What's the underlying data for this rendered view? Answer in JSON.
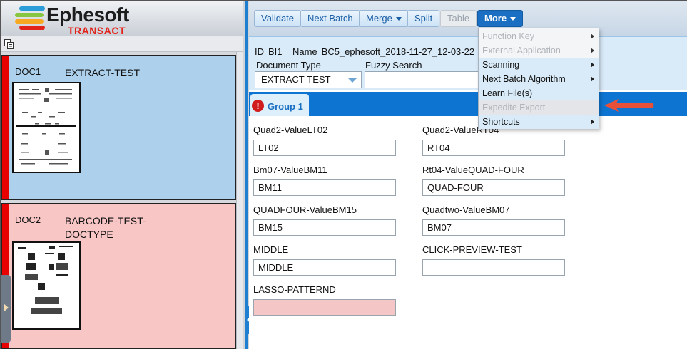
{
  "logo": {
    "word": "Ephesoft",
    "sub": "TRANSACT",
    "colors": [
      "#2a9cd8",
      "#88c540",
      "#f7a823",
      "#e2231a"
    ]
  },
  "left_toolbar": {
    "icon": "copy-icon"
  },
  "documents": [
    {
      "id": "DOC1",
      "type": "EXTRACT-TEST",
      "status_color": "#add1ec"
    },
    {
      "id": "DOC2",
      "type": "BARCODE-TEST-DOCTYPE",
      "status_color": "#f9c6c6"
    }
  ],
  "toolbar": {
    "validate": "Validate",
    "next_batch": "Next Batch",
    "merge": "Merge",
    "split": "Split",
    "table": "Table",
    "more": "More"
  },
  "more_menu": {
    "items": [
      {
        "label": "Function Key",
        "enabled": false,
        "submenu": true
      },
      {
        "label": "External Application",
        "enabled": false,
        "submenu": true
      },
      {
        "label": "Scanning",
        "enabled": true,
        "submenu": true
      },
      {
        "label": "Next Batch Algorithm",
        "enabled": true,
        "submenu": true
      },
      {
        "label": "Learn File(s)",
        "enabled": true,
        "submenu": false
      },
      {
        "label": "Expedite Export",
        "enabled": false,
        "submenu": false
      },
      {
        "label": "Shortcuts",
        "enabled": true,
        "submenu": true
      }
    ]
  },
  "batch": {
    "id_label": "ID",
    "id_value": "BI1",
    "name_label": "Name",
    "name_value": "BC5_ephesoft_2018-11-27_12-03-22",
    "doc_type_label": "Document Type",
    "doc_type_value": "EXTRACT-TEST",
    "fuzzy_label": "Fuzzy Search",
    "fuzzy_value": ""
  },
  "group": {
    "label": "Group 1",
    "has_error": true,
    "error_glyph": "!"
  },
  "fields": [
    {
      "label": "Quad2-ValueLT02",
      "value": "LT02",
      "invalid": false
    },
    {
      "label": "Quad2-ValueRT04",
      "value": "RT04",
      "invalid": false
    },
    {
      "label": "Bm07-ValueBM11",
      "value": "BM11",
      "invalid": false
    },
    {
      "label": "Rt04-ValueQUAD-FOUR",
      "value": "QUAD-FOUR",
      "invalid": false
    },
    {
      "label": "QUADFOUR-ValueBM15",
      "value": "BM15",
      "invalid": false
    },
    {
      "label": "Quadtwo-ValueBM07",
      "value": "BM07",
      "invalid": false
    },
    {
      "label": "MIDDLE",
      "value": "MIDDLE",
      "invalid": false
    },
    {
      "label": "CLICK-PREVIEW-TEST",
      "value": "",
      "invalid": false
    },
    {
      "label": "LASSO-PATTERND",
      "value": "",
      "invalid": true
    }
  ],
  "annotation": {
    "arrow_color": "#e8503a",
    "points_to": "Expedite Export"
  }
}
